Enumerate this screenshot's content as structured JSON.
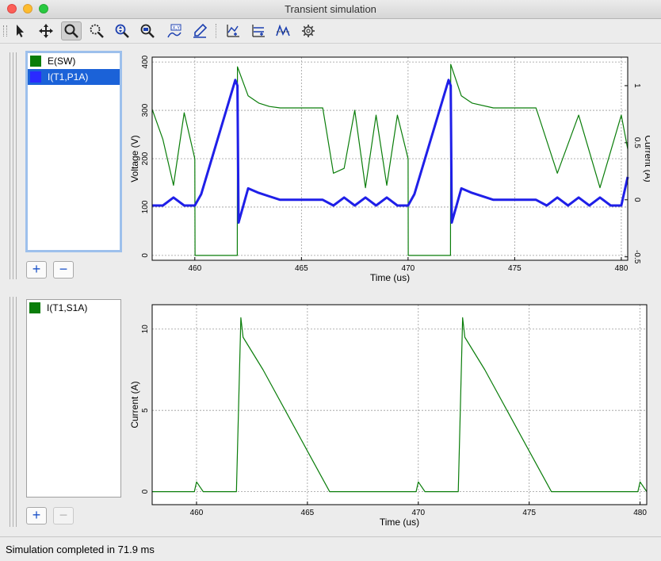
{
  "window": {
    "title": "Transient simulation"
  },
  "toolbar": {
    "tools": [
      {
        "name": "pointer-tool",
        "icon": "arrow-cursor-icon"
      },
      {
        "name": "pan-tool",
        "icon": "move-arrows-icon"
      },
      {
        "name": "zoom-tool",
        "icon": "magnifier-icon",
        "active": true
      },
      {
        "name": "zoom-box-tool",
        "icon": "zoom-box-icon"
      },
      {
        "name": "zoom-in-tool",
        "icon": "zoom-in-icon"
      },
      {
        "name": "zoom-out-tool",
        "icon": "zoom-out-icon"
      },
      {
        "name": "xy-tool",
        "icon": "xy-axes-icon"
      },
      {
        "name": "measure-tool",
        "icon": "pen-measure-icon"
      },
      {
        "name": "add-plot-tool",
        "icon": "add-plot-icon"
      },
      {
        "name": "add-curve-tool",
        "icon": "add-curve-icon"
      },
      {
        "name": "curve-tool",
        "icon": "curve-icon"
      },
      {
        "name": "settings-tool",
        "icon": "gear-icon"
      }
    ]
  },
  "panels": [
    {
      "legend": [
        {
          "label": "E(SW)",
          "color": "#0a7d0a",
          "selected": false
        },
        {
          "label": "I(T1,P1A)",
          "color": "#1f1fe8",
          "selected": true
        }
      ]
    },
    {
      "legend": [
        {
          "label": "I(T1,S1A)",
          "color": "#0a7d0a",
          "selected": false
        }
      ]
    }
  ],
  "chart_data": [
    {
      "type": "line",
      "xlabel": "Time (us)",
      "ylabel": "Voltage (V)",
      "y2label": "Current (A)",
      "xlim": [
        458,
        480.3
      ],
      "ylim": [
        -10,
        410
      ],
      "y2lim": [
        -0.53,
        1.25
      ],
      "xticks": [
        "460",
        "465",
        "470",
        "475",
        "480"
      ],
      "yticks": [
        "0",
        "100",
        "200",
        "300",
        "400"
      ],
      "y2ticks": [
        "-0.5",
        "0",
        "0.5",
        "1"
      ],
      "grid": true,
      "series": [
        {
          "name": "E(SW)",
          "color": "#0a7d0a",
          "axis": "left",
          "x": [
            458,
            458.5,
            459,
            459.5,
            460,
            460.01,
            461.99,
            462,
            462.5,
            463,
            463.5,
            464,
            464.5,
            465,
            465.5,
            466,
            466.5,
            467,
            467.5,
            468,
            468.5,
            469,
            469.5,
            470,
            470.01,
            471.99,
            472,
            472.5,
            473,
            474,
            475,
            476,
            477,
            478,
            479,
            480,
            480.3
          ],
          "y": [
            302,
            240,
            145,
            295,
            200,
            0,
            0,
            390,
            330,
            315,
            308,
            305,
            305,
            305,
            305,
            305,
            170,
            180,
            300,
            140,
            290,
            145,
            290,
            200,
            0,
            0,
            395,
            330,
            315,
            305,
            305,
            305,
            170,
            290,
            140,
            290,
            220
          ]
        },
        {
          "name": "I(T1,P1A)",
          "color": "#1f1fe8",
          "axis": "right",
          "x": [
            458,
            458.5,
            459,
            459.5,
            460,
            460.3,
            461.9,
            462,
            462.05,
            462.5,
            463,
            463.5,
            464,
            465,
            466,
            466.5,
            467,
            467.5,
            468,
            468.5,
            469,
            469.5,
            470,
            470.3,
            471.9,
            472,
            472.05,
            472.5,
            473,
            474,
            475,
            476,
            476.5,
            477,
            477.5,
            478,
            478.5,
            479,
            479.5,
            480,
            480.3
          ],
          "y": [
            -0.05,
            -0.05,
            0.02,
            -0.05,
            -0.05,
            0.05,
            1.05,
            1.0,
            -0.2,
            0.1,
            0.06,
            0.03,
            0.0,
            0.0,
            0.0,
            -0.05,
            0.02,
            -0.05,
            0.02,
            -0.05,
            0.02,
            -0.05,
            -0.05,
            0.05,
            1.05,
            1.0,
            -0.2,
            0.1,
            0.06,
            0.0,
            0.0,
            0.0,
            -0.05,
            0.02,
            -0.05,
            0.02,
            -0.05,
            0.02,
            -0.05,
            -0.05,
            0.2
          ]
        }
      ]
    },
    {
      "type": "line",
      "xlabel": "Time (us)",
      "ylabel": "Current (A)",
      "xlim": [
        458,
        480.3
      ],
      "ylim": [
        -0.8,
        11.5
      ],
      "xticks": [
        "460",
        "465",
        "470",
        "475",
        "480"
      ],
      "yticks": [
        "0",
        "5",
        "10"
      ],
      "grid": true,
      "series": [
        {
          "name": "I(T1,S1A)",
          "color": "#0a7d0a",
          "axis": "left",
          "x": [
            458,
            459.9,
            460,
            460.3,
            461.8,
            462,
            462.1,
            463,
            464,
            465,
            466,
            467,
            469.9,
            470,
            470.3,
            471.8,
            472,
            472.1,
            473,
            474,
            475,
            476,
            477,
            479.9,
            480,
            480.3
          ],
          "y": [
            0,
            0,
            0.6,
            0,
            0,
            10.7,
            9.5,
            7.5,
            5.0,
            2.5,
            0.0,
            0,
            0,
            0.6,
            0,
            0,
            10.7,
            9.5,
            7.5,
            5.0,
            2.5,
            0.0,
            0,
            0,
            0.6,
            0
          ]
        }
      ]
    }
  ],
  "status": {
    "text": "Simulation completed in 71.9 ms"
  }
}
